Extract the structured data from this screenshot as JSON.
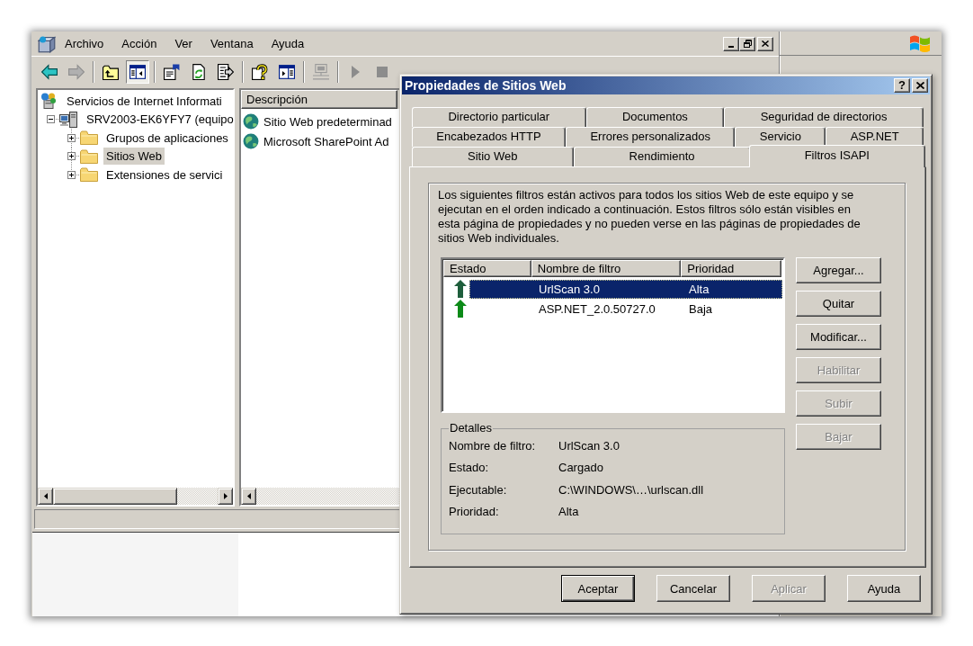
{
  "menu": [
    "Archivo",
    "Acción",
    "Ver",
    "Ventana",
    "Ayuda"
  ],
  "toolbar": {
    "groups": [
      [
        {
          "kind": "back",
          "disabled": false,
          "pressed": false
        },
        {
          "kind": "forward",
          "disabled": true,
          "pressed": false
        }
      ],
      [
        {
          "kind": "up",
          "disabled": false,
          "pressed": false
        },
        {
          "kind": "tree",
          "disabled": false,
          "pressed": true
        }
      ],
      [
        {
          "kind": "properties",
          "disabled": false,
          "pressed": false
        },
        {
          "kind": "refresh",
          "disabled": false,
          "pressed": false
        },
        {
          "kind": "export",
          "disabled": false,
          "pressed": false
        }
      ],
      [
        {
          "kind": "help",
          "disabled": false,
          "pressed": false
        },
        {
          "kind": "panel",
          "disabled": false,
          "pressed": false
        }
      ],
      [
        {
          "kind": "computer",
          "disabled": true,
          "pressed": false
        }
      ],
      [
        {
          "kind": "play",
          "disabled": true,
          "pressed": false
        },
        {
          "kind": "stop",
          "disabled": true,
          "pressed": false
        }
      ]
    ]
  },
  "tree": [
    {
      "label": "Servicios de Internet Informati",
      "kind": "iis",
      "selected": false,
      "children": [
        {
          "label": "SRV2003-EK6YFY7 (equipo",
          "kind": "server",
          "expanded": true,
          "selected": false,
          "children": [
            {
              "label": "Grupos de aplicaciones",
              "kind": "folder",
              "expanded": false,
              "selected": false
            },
            {
              "label": "Sitios Web",
              "kind": "folder",
              "expanded": false,
              "selected": true
            },
            {
              "label": "Extensiones de servici",
              "kind": "folder",
              "expanded": false,
              "selected": false
            }
          ]
        }
      ]
    }
  ],
  "list": {
    "columns": [
      "Descripción"
    ],
    "items": [
      {
        "label": "Sitio Web predeterminad",
        "selected": false
      },
      {
        "label": "Microsoft SharePoint Ad",
        "selected": false
      }
    ]
  },
  "dialog": {
    "title": "Propiedades de Sitios Web",
    "help_button": "?",
    "tab_rows": [
      [
        {
          "label": "Directorio particular",
          "selected": false
        },
        {
          "label": "Documentos",
          "selected": false
        },
        {
          "label": "Seguridad de directorios",
          "selected": false
        }
      ],
      [
        {
          "label": "Encabezados HTTP",
          "selected": false
        },
        {
          "label": "Errores personalizados",
          "selected": false
        },
        {
          "label": "Servicio",
          "selected": false
        },
        {
          "label": "ASP.NET",
          "selected": false
        }
      ],
      [
        {
          "label": "Sitio Web",
          "selected": false
        },
        {
          "label": "Rendimiento",
          "selected": false
        },
        {
          "label": "Filtros ISAPI",
          "selected": true
        }
      ]
    ],
    "description": "Los siguientes filtros están activos para todos los sitios Web de este equipo y se ejecutan en el orden indicado a continuación. Estos filtros sólo están visibles en esta página de propiedades y no pueden verse en las páginas de propiedades de sitios Web individuales.",
    "filters": {
      "columns": [
        "Estado",
        "Nombre de filtro",
        "Prioridad"
      ],
      "rows": [
        {
          "loaded": true,
          "name": "UrlScan 3.0",
          "priority": "Alta",
          "selected": true
        },
        {
          "loaded": true,
          "name": "ASP.NET_2.0.50727.0",
          "priority": "Baja",
          "selected": false
        }
      ]
    },
    "side_buttons": [
      {
        "label": "Agregar...",
        "disabled": false
      },
      {
        "label": "Quitar",
        "disabled": false
      },
      {
        "label": "Modificar...",
        "disabled": false
      },
      {
        "label": "Habilitar",
        "disabled": true
      },
      {
        "label": "Subir",
        "disabled": true
      },
      {
        "label": "Bajar",
        "disabled": true
      }
    ],
    "details": {
      "title": "Detalles",
      "fields": [
        {
          "label": "Nombre de filtro:",
          "value": "UrlScan 3.0"
        },
        {
          "label": "Estado:",
          "value": "Cargado"
        },
        {
          "label": "Ejecutable:",
          "value": "C:\\WINDOWS\\…\\urlscan.dll"
        },
        {
          "label": "Prioridad:",
          "value": "Alta"
        }
      ]
    },
    "buttons": [
      {
        "label": "Aceptar",
        "disabled": false,
        "default": true
      },
      {
        "label": "Cancelar",
        "disabled": false,
        "default": false
      },
      {
        "label": "Aplicar",
        "disabled": true,
        "default": false
      },
      {
        "label": "Ayuda",
        "disabled": false,
        "default": false
      }
    ]
  }
}
